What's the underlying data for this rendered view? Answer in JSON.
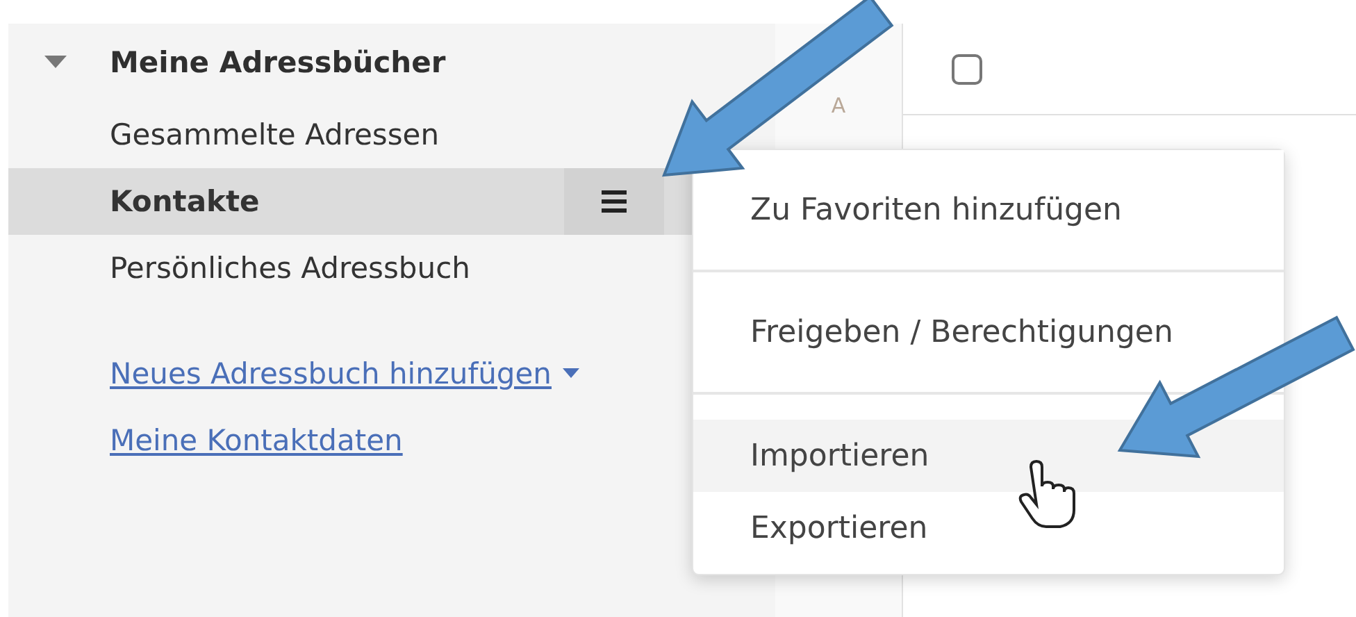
{
  "sidebar": {
    "group": {
      "label": "Meine Adressbücher",
      "expanded": true,
      "children": [
        {
          "label": "Gesammelte Adressen",
          "selected": false
        },
        {
          "label": "Kontakte",
          "selected": true
        },
        {
          "label": "Persönliches Adressbuch",
          "selected": false
        }
      ]
    },
    "links": [
      {
        "label": "Neues Adressbuch hinzufügen",
        "dropdown": true
      },
      {
        "label": "Meine Kontaktdaten",
        "dropdown": false
      }
    ]
  },
  "alphabet": [
    "A"
  ],
  "list_header": {
    "checked": false
  },
  "context_menu": {
    "items": [
      {
        "label": "Zu Favoriten hinzufügen",
        "selected": false,
        "divider_after": true
      },
      {
        "label": "Freigeben / Berechtigungen",
        "selected": false,
        "divider_after": true
      },
      {
        "label": "Importieren",
        "selected": true,
        "divider_after": false
      },
      {
        "label": "Exportieren",
        "selected": false,
        "divider_after": false
      }
    ]
  }
}
